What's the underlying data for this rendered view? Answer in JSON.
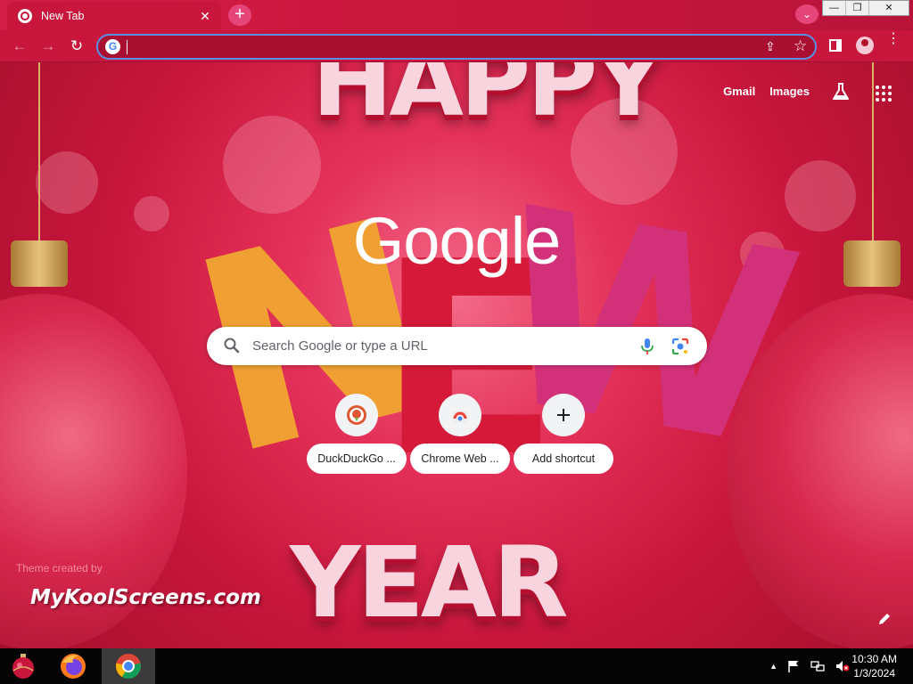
{
  "browser": {
    "tab_title": "New Tab",
    "tab_close": "✕",
    "new_tab": "+",
    "tab_search": "⌄",
    "window_controls": {
      "minimize": "—",
      "maximize": "❐",
      "close": "✕"
    },
    "toolbar": {
      "back": "←",
      "forward": "→",
      "reload": "↻",
      "address_value": "",
      "share": "⇪",
      "bookmark": "☆",
      "menu": "⋮"
    }
  },
  "ntp": {
    "top_links": [
      "Gmail",
      "Images"
    ],
    "logo": "Google",
    "search_placeholder": "Search Google or type a URL",
    "shortcuts": [
      {
        "label": "DuckDuckGo ...",
        "icon": "duckduckgo-icon"
      },
      {
        "label": "Chrome Web ...",
        "icon": "chrome-web-store-icon"
      },
      {
        "label": "Add shortcut",
        "icon": "plus-icon"
      }
    ],
    "theme_credit": "Theme created by",
    "theme_brand": "MyKoolScreens.com",
    "background_text": {
      "top": "HAPPY",
      "middle": "NEW",
      "bottom": "YEAR"
    }
  },
  "taskbar": {
    "apps": [
      "ornament-start-icon",
      "firefox-icon",
      "chrome-icon"
    ],
    "clock_time": "10:30 AM",
    "clock_date": "1/3/2024",
    "tray_arrow": "▲"
  },
  "colors": {
    "theme": "#c8163c",
    "accent": "#5b8fe6"
  }
}
